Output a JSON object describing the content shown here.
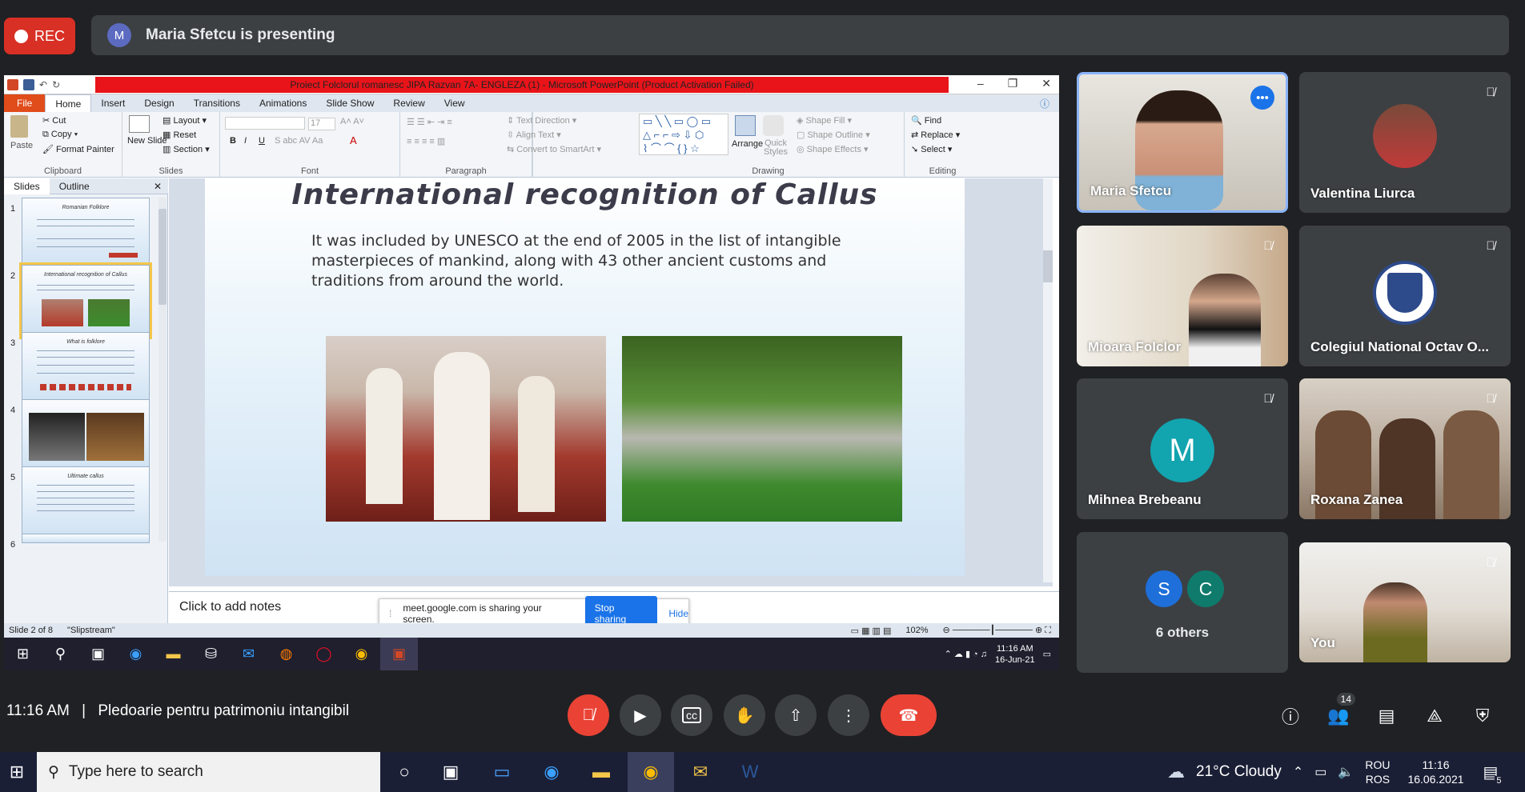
{
  "meet": {
    "rec_label": "REC",
    "presenter_initial": "M",
    "presenting_text": "Maria Sfetcu is presenting",
    "time": "11:16 AM",
    "separator": "|",
    "meeting_name": "Pledoarie pentru patrimoniu intangibil",
    "people_count": "14",
    "participants": [
      {
        "name": "Maria Sfetcu",
        "speaking": true
      },
      {
        "name": "Valentina Liurca",
        "muted": true
      },
      {
        "name": "Mioara Folclor",
        "muted": true
      },
      {
        "name": "Colegiul National Octav O...",
        "muted": true
      },
      {
        "name": "Mihnea Brebeanu",
        "initial": "M",
        "muted": true
      },
      {
        "name": "Roxana Zanea",
        "muted": true
      },
      {
        "name": "6 others",
        "initials": [
          "S",
          "C"
        ]
      },
      {
        "name": "You",
        "muted": true
      }
    ]
  },
  "ppt": {
    "window_title": "Proiect Folclorul romanesc JIPA Razvan 7A- ENGLEZA (1) - Microsoft PowerPoint (Product Activation Failed)",
    "tabs": [
      "File",
      "Home",
      "Insert",
      "Design",
      "Transitions",
      "Animations",
      "Slide Show",
      "Review",
      "View"
    ],
    "ribbon": {
      "paste": "Paste",
      "cut": "Cut",
      "copy": "Copy",
      "format_painter": "Format Painter",
      "clipboard": "Clipboard",
      "new_slide": "New Slide",
      "layout": "Layout",
      "reset": "Reset",
      "section": "Section",
      "slides": "Slides",
      "font_size": "17",
      "font": "Font",
      "text_direction": "Text Direction",
      "align_text": "Align Text",
      "convert_smartart": "Convert to SmartArt",
      "paragraph": "Paragraph",
      "arrange": "Arrange",
      "quick_styles": "Quick Styles",
      "shape_fill": "Shape Fill",
      "shape_outline": "Shape Outline",
      "shape_effects": "Shape Effects",
      "drawing": "Drawing",
      "find": "Find",
      "replace": "Replace",
      "select": "Select",
      "editing": "Editing"
    },
    "pane_tabs": [
      "Slides",
      "Outline"
    ],
    "thumbnails": [
      {
        "num": "1",
        "title": "Romanian Folklore"
      },
      {
        "num": "2",
        "title": "International recognition of Callus"
      },
      {
        "num": "3",
        "title": "What is folklore"
      },
      {
        "num": "4",
        "title": ""
      },
      {
        "num": "5",
        "title": "Ultimate callus"
      },
      {
        "num": "6",
        "title": ""
      }
    ],
    "slide_title": "International recognition of Callus",
    "slide_body": "It was included by UNESCO at the end of 2005 in the list of intangible masterpieces of mankind, along with 43 other ancient customs and traditions from around the world.",
    "notes_placeholder": "Click to add notes",
    "status_slide": "Slide 2 of 8",
    "status_theme": "\"Slipstream\"",
    "zoom": "102%",
    "share_text": "meet.google.com is sharing your screen.",
    "stop_sharing": "Stop sharing",
    "hide": "Hide",
    "inner_time": "11:16 AM",
    "inner_date": "16-Jun-21"
  },
  "taskbar": {
    "search_placeholder": "Type here to search",
    "weather": "21°C  Cloudy",
    "lang1": "ROU",
    "lang2": "ROS",
    "time": "11:16",
    "date": "16.06.2021",
    "notif_count": "5"
  }
}
